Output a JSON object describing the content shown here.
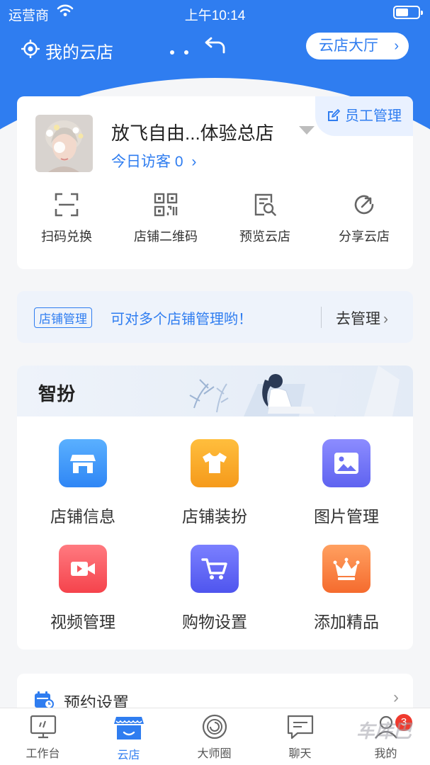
{
  "status_bar": {
    "carrier": "运营商",
    "time": "上午10:14"
  },
  "nav": {
    "title": "我的云店",
    "hall_button": "云店大厅",
    "chevron": "›"
  },
  "store": {
    "name": "放飞自由...体验总店",
    "visitors": "今日访客 0",
    "visitors_chevron": "›",
    "staff_button": "员工管理"
  },
  "quick_actions": [
    {
      "label": "扫码兑换",
      "icon": "scan-icon"
    },
    {
      "label": "店铺二维码",
      "icon": "qrcode-icon"
    },
    {
      "label": "预览云店",
      "icon": "preview-icon"
    },
    {
      "label": "分享云店",
      "icon": "share-icon"
    }
  ],
  "manage_bar": {
    "tag": "店铺管理",
    "tip": "可对多个店铺管理哟！",
    "go": "去管理",
    "chevron": "›"
  },
  "smart": {
    "title": "智扮",
    "tiles": [
      {
        "label": "店铺信息",
        "icon": "store-icon",
        "color_top": "#5ab0ff",
        "color_bottom": "#2f86f5"
      },
      {
        "label": "店铺装扮",
        "icon": "shirt-icon",
        "color_top": "#ffbe3d",
        "color_bottom": "#f59a1b"
      },
      {
        "label": "图片管理",
        "icon": "image-icon",
        "color_top": "#8c8cff",
        "color_bottom": "#5f63f0"
      },
      {
        "label": "视频管理",
        "icon": "video-icon",
        "color_top": "#ff7a80",
        "color_bottom": "#f5434c"
      },
      {
        "label": "购物设置",
        "icon": "cart-icon",
        "color_top": "#7b80ff",
        "color_bottom": "#4f55ee"
      },
      {
        "label": "添加精品",
        "icon": "crown-icon",
        "color_top": "#ffa060",
        "color_bottom": "#f56b2e"
      }
    ]
  },
  "booking": {
    "label": "预约设置",
    "chevron": "›"
  },
  "tabbar": {
    "items": [
      {
        "label": "工作台",
        "icon": "workbench-icon"
      },
      {
        "label": "云店",
        "icon": "cloud-store-icon"
      },
      {
        "label": "大师圈",
        "icon": "master-circle-icon"
      },
      {
        "label": "聊天",
        "icon": "chat-icon"
      },
      {
        "label": "我的",
        "icon": "profile-icon"
      }
    ],
    "active": "云店",
    "badge": "3"
  },
  "watermark": "车库巴",
  "colors": {
    "primary": "#2f7df0",
    "background": "#f5f6f8",
    "badge": "#f03a2e"
  }
}
